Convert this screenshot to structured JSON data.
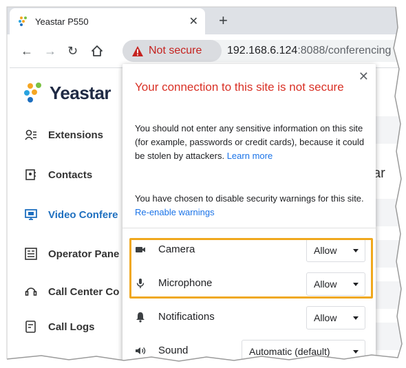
{
  "browser": {
    "tab_title": "Yeastar P550",
    "security_chip": "Not secure",
    "url_host": "192.168.6.124",
    "url_rest": ":8088/conferencing"
  },
  "app": {
    "logo_text": "Yeastar",
    "nav": [
      {
        "label": "Extensions",
        "icon": "extensions-icon"
      },
      {
        "label": "Contacts",
        "icon": "contacts-icon"
      },
      {
        "label": "Video Confere",
        "icon": "video-conference-icon",
        "active": true
      },
      {
        "label": "Operator Pane",
        "icon": "operator-panel-icon"
      },
      {
        "label": "Call Center Co",
        "icon": "call-center-icon"
      },
      {
        "label": "Call Logs",
        "icon": "call-logs-icon"
      }
    ],
    "partial_text": "ar"
  },
  "popup": {
    "title": "Your connection to this site is not secure",
    "body1": "You should not enter any sensitive information on this site (for example, passwords or credit cards), because it could be stolen by attackers.",
    "learn_more": "Learn more",
    "body2": "You have chosen to disable security warnings for this site.",
    "reenable": "Re-enable warnings",
    "permissions": [
      {
        "label": "Camera",
        "value": "Allow",
        "icon": "camera-icon"
      },
      {
        "label": "Microphone",
        "value": "Allow",
        "icon": "microphone-icon"
      },
      {
        "label": "Notifications",
        "value": "Allow",
        "icon": "bell-icon"
      },
      {
        "label": "Sound",
        "value": "Automatic (default)",
        "icon": "speaker-icon"
      }
    ]
  },
  "colors": {
    "warning_red": "#c5221f",
    "link_blue": "#1a73e8",
    "highlight": "#f0a81c",
    "active_nav": "#1e6fbf"
  }
}
